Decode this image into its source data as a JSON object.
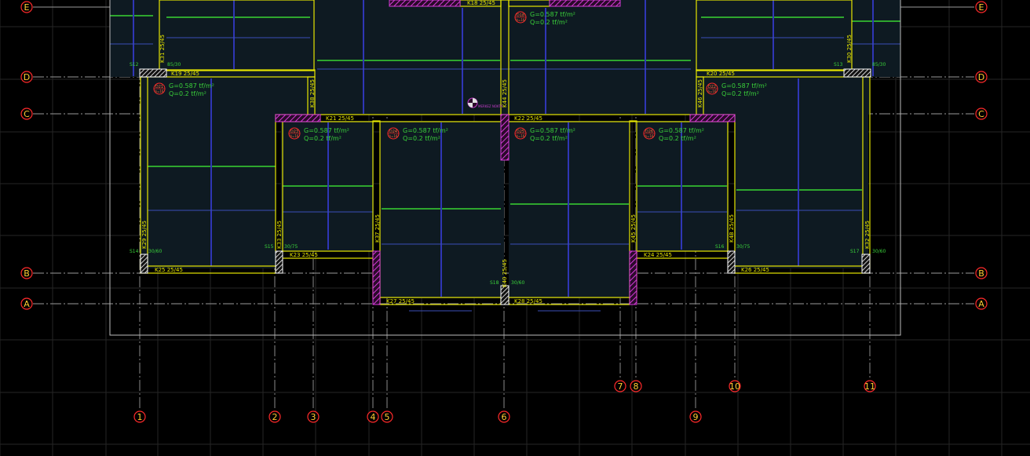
{
  "view": {
    "background": "#000000",
    "colors": {
      "grid": "#2a2a2a",
      "axis": "#bbbbbb",
      "beam": "#e6e600",
      "slab": "#0f1b24",
      "rebar_main": "#2ea62e",
      "rebar_dist": "#2f36b5",
      "dim": "#3b4fb8",
      "column_hatch": "#ffffff",
      "shear_wall": "#c43bc8",
      "bubble": "#ff2a2a",
      "bubble_text": "#ffcc33",
      "label": "#e6e600",
      "load_text": "#3ad13a"
    }
  },
  "axes": {
    "rows": [
      {
        "label": "E"
      },
      {
        "label": "D"
      },
      {
        "label": "C"
      },
      {
        "label": "B"
      },
      {
        "label": "A"
      }
    ],
    "cols": [
      {
        "label": "1"
      },
      {
        "label": "2"
      },
      {
        "label": "3"
      },
      {
        "label": "4"
      },
      {
        "label": "5"
      },
      {
        "label": "6"
      },
      {
        "label": "7"
      },
      {
        "label": "8"
      },
      {
        "label": "9"
      },
      {
        "label": "10"
      },
      {
        "label": "11"
      }
    ]
  },
  "beams": [
    {
      "label": "K18 25/45"
    },
    {
      "label": "K19 25/45"
    },
    {
      "label": "K20 25/45"
    },
    {
      "label": "K21 25/45"
    },
    {
      "label": "K22 25/45"
    },
    {
      "label": "K23 25/45"
    },
    {
      "label": "K24 25/45"
    },
    {
      "label": "K25 25/45"
    },
    {
      "label": "K26 25/45"
    },
    {
      "label": "K27 25/45"
    },
    {
      "label": "K28 25/45"
    },
    {
      "label": "K31 25/45"
    },
    {
      "label": "K30 25/45"
    },
    {
      "label": "K29 25/45"
    },
    {
      "label": "K32 25/45"
    },
    {
      "label": "K33 25/45"
    },
    {
      "label": "K38 25/45"
    },
    {
      "label": "K37 25/45"
    },
    {
      "label": "K44 25/45"
    },
    {
      "label": "K40 25/45"
    },
    {
      "label": "K45 25/45"
    },
    {
      "label": "K46 25/45"
    },
    {
      "label": "K48 25/45"
    }
  ],
  "slabs": [
    {
      "id": "D18",
      "sub": "h=16",
      "g": "G=0.587 tf/m²",
      "q": "Q=0.2 tf/m²"
    },
    {
      "id": "D21",
      "sub": "h=16",
      "g": "G=0.587 tf/m²",
      "q": "Q=0.2 tf/m²"
    },
    {
      "id": "D22",
      "sub": "h=16",
      "g": "G=0.587 tf/m²",
      "q": "Q=0.2 tf/m²"
    },
    {
      "id": "D23",
      "sub": "h=16",
      "g": "G=0.587 tf/m²",
      "q": "Q=0.2 tf/m²"
    },
    {
      "id": "D24",
      "sub": "h=16",
      "g": "G=0.587 tf/m²",
      "q": "Q=0.2 tf/m²"
    },
    {
      "id": "D25",
      "sub": "h=16",
      "g": "G=0.587 tf/m²",
      "q": "Q=0.2 tf/m²"
    },
    {
      "id": "D26",
      "sub": "h=16",
      "g": "G=0.587 tf/m²",
      "q": "Q=0.2 tf/m²"
    }
  ],
  "columns": [
    {
      "label": "S12"
    },
    {
      "label": "S13"
    },
    {
      "label": "S14"
    },
    {
      "label": "S15"
    },
    {
      "label": "S16"
    },
    {
      "label": "S17"
    },
    {
      "label": "S18"
    }
  ],
  "column_sizes": [
    {
      "label": "85/30"
    },
    {
      "label": "85/30"
    },
    {
      "label": "30/60"
    },
    {
      "label": "30/75"
    },
    {
      "label": "30/75"
    },
    {
      "label": "30/60"
    },
    {
      "label": "30/60"
    }
  ],
  "ucs": {
    "label": "MERKEZ NOKTA"
  }
}
